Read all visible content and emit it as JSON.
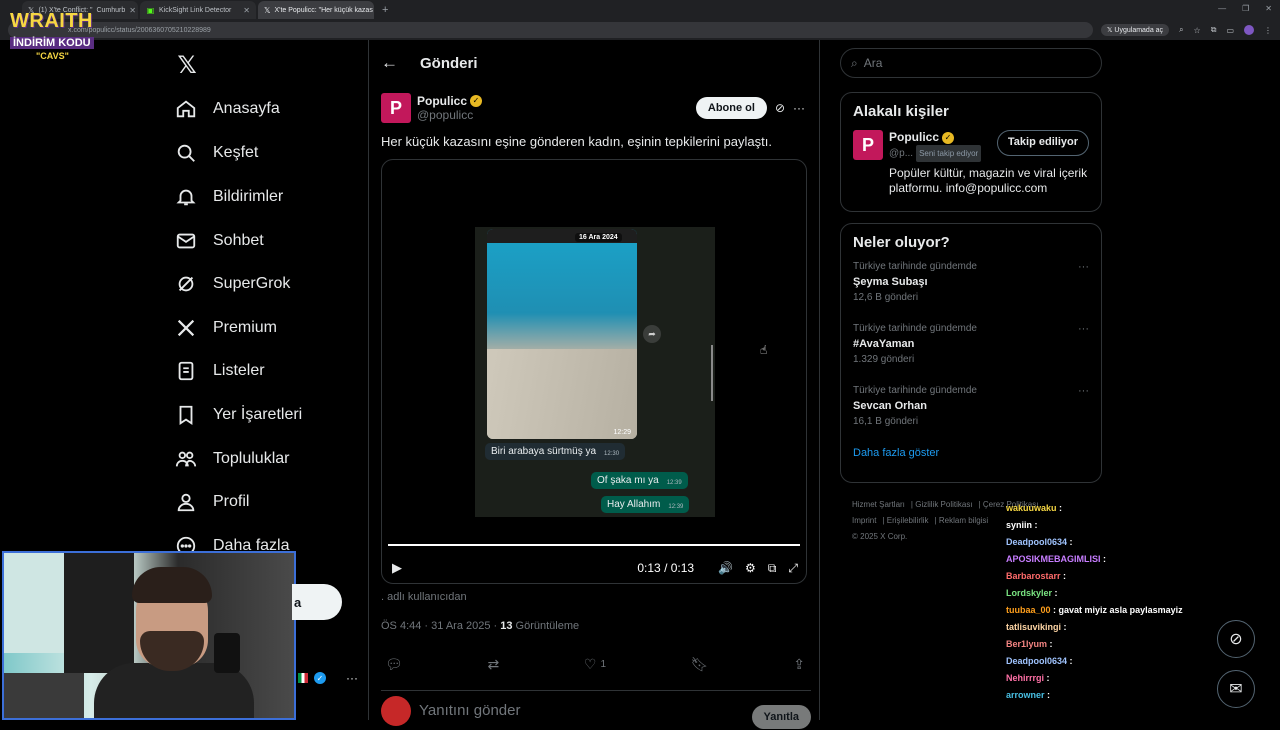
{
  "browser": {
    "tabs": [
      {
        "label": "(1) X'te Conflict: \"",
        "extra": "Cumhurb"
      },
      {
        "label": "KickSight Link Detector"
      },
      {
        "label": "X'te Populicc: \"Her küçük kazas"
      }
    ],
    "url": "x.com/populicc/status/2006360705210228989",
    "app_pill": "Uygulamada aç"
  },
  "overlay_logo": {
    "line1": "WRAITH",
    "line2": "İNDİRİM KODU",
    "line3": "\"CAVS\""
  },
  "leftnav": {
    "items": [
      {
        "label": "Anasayfa",
        "icon": "home-icon"
      },
      {
        "label": "Keşfet",
        "icon": "search-icon"
      },
      {
        "label": "Bildirimler",
        "icon": "bell-icon"
      },
      {
        "label": "Sohbet",
        "icon": "mail-icon"
      },
      {
        "label": "SuperGrok",
        "icon": "grok-icon"
      },
      {
        "label": "Premium",
        "icon": "x-icon"
      },
      {
        "label": "Listeler",
        "icon": "list-icon"
      },
      {
        "label": "Yer İşaretleri",
        "icon": "bookmark-icon"
      },
      {
        "label": "Topluluklar",
        "icon": "people-icon"
      },
      {
        "label": "Profil",
        "icon": "person-icon"
      },
      {
        "label": "Daha fazla",
        "icon": "more-circle-icon"
      }
    ],
    "post_button_peek": "a"
  },
  "main": {
    "header_title": "Gönderi",
    "author": {
      "name": "Populicc",
      "handle": "@populicc",
      "avatar_letter": "P"
    },
    "subscribe_label": "Abone ol",
    "text": "Her küçük kazasını eşine gönderen kadın, eşinin tepkilerini paylaştı.",
    "video": {
      "date_chip": "16 Ara 2024",
      "image_time": "12:29",
      "messages": [
        {
          "text": "Biri arabaya sürtmüş ya",
          "time": "12:30",
          "dir": "in"
        },
        {
          "text": "Of şaka mı ya",
          "time": "12:39",
          "dir": "out"
        },
        {
          "text": "Hay Allahım",
          "time": "12:39",
          "dir": "out"
        }
      ],
      "time_display": "0:13 / 0:13"
    },
    "user_line": ". adlı kullanıcıdan",
    "meta": {
      "time": "ÖS 4:44 · 31 Ara 2025 · ",
      "views": "13",
      "views_label": " Görüntüleme"
    },
    "actions": {
      "likes": "1"
    },
    "reply": {
      "placeholder": "Yanıtını gönder",
      "button": "Yanıtla"
    }
  },
  "right": {
    "search_placeholder": "Ara",
    "related": {
      "title": "Alakalı kişiler",
      "name": "Populicc",
      "handle": "@p...",
      "follows_you": "Seni takip ediyor",
      "follow_button": "Takip ediliyor",
      "bio": "Popüler kültür, magazin ve viral içerik platformu. info@populicc.com"
    },
    "trends": {
      "title": "Neler oluyor?",
      "items": [
        {
          "context": "Türkiye tarihinde gündemde",
          "name": "Şeyma Subaşı",
          "count": "12,6 B gönderi"
        },
        {
          "context": "Türkiye tarihinde gündemde",
          "name": "#AvaYaman",
          "count": "1.329 gönderi"
        },
        {
          "context": "Türkiye tarihinde gündemde",
          "name": "Sevcan Orhan",
          "count": "16,1 B gönderi"
        }
      ],
      "show_more": "Daha fazla göster"
    },
    "footer": {
      "l1": [
        "Hizmet Şartları",
        "Gizlilik Politikası",
        "Çerez Politikası"
      ],
      "l2": [
        "Imprint",
        "Erişilebilirlik",
        "Reklam bilgisi"
      ],
      "copyright": "© 2025 X Corp."
    }
  },
  "stream_chat": [
    {
      "user": "wakuuwaku",
      "msg": ""
    },
    {
      "user": "syniin",
      "msg": ""
    },
    {
      "user": "Deadpool0634",
      "msg": ""
    },
    {
      "user": "APOSIKMEBAGIMLISI",
      "msg": ""
    },
    {
      "user": "Barbarostarr",
      "msg": ""
    },
    {
      "user": "Lordskyler",
      "msg": ""
    },
    {
      "user": "tuubaa_00",
      "msg": "gavat miyiz asla paylasmayiz"
    },
    {
      "user": "tatlisuvikingi",
      "msg": ""
    },
    {
      "user": "Ber1lyum",
      "msg": ""
    },
    {
      "user": "Deadpool0634",
      "msg": ""
    },
    {
      "user": "Nehirrrgi",
      "msg": ""
    },
    {
      "user": "arrowner",
      "msg": ""
    }
  ],
  "colors": {
    "accent": "#1d9bf0",
    "brand_pink": "#c2185b",
    "chat_users": [
      "#f6d743",
      "#ffffff",
      "#a0c4ff",
      "#c77dff",
      "#ff6b6b",
      "#7ae582",
      "#ff9f1c",
      "#ffd6a5",
      "#f28482",
      "#a0c4ff",
      "#ff70a6",
      "#48bfe3"
    ]
  }
}
